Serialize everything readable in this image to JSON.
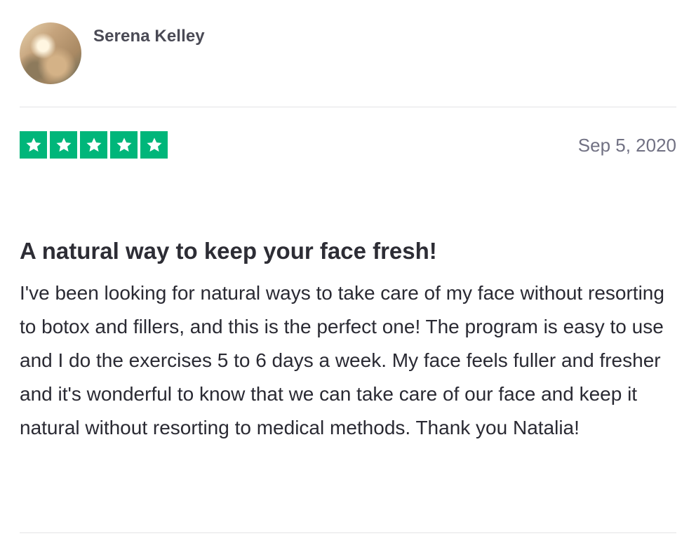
{
  "reviewer": {
    "name": "Serena Kelley"
  },
  "rating": {
    "stars": 5,
    "max": 5,
    "star_color": "#00b67a"
  },
  "review": {
    "date": "Sep 5, 2020",
    "title": "A natural way to keep your face fresh!",
    "body": "I've been looking for natural ways to take care of my face without resorting to botox and fillers, and this is the perfect one! The program is easy to use and I do the exercises 5 to 6 days a week. My face feels fuller and fresher and it's wonderful to know that we can take care of our face and keep it natural without resorting to medical methods. Thank you Natalia!"
  }
}
